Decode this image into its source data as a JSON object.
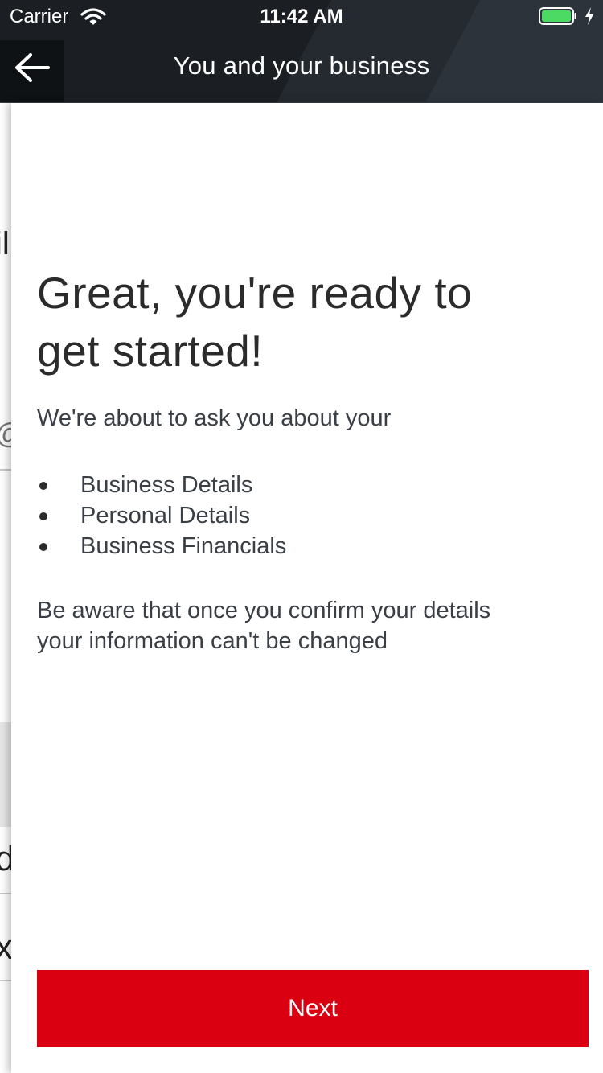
{
  "status_bar": {
    "carrier": "Carrier",
    "time": "11:42 AM",
    "icons": [
      "wifi-icon",
      "battery-icon",
      "charging-icon"
    ],
    "battery_color": "#4cd964"
  },
  "nav": {
    "back_icon": "arrow-left-icon",
    "title": "You and your business"
  },
  "content": {
    "headline_line1": "Great, you're ready to",
    "headline_line2": "get started!",
    "intro": "We're about to ask you about your",
    "topics": [
      "Business Details",
      "Personal Details",
      "Business Financials"
    ],
    "warning_line1": "Be aware that once you confirm your details",
    "warning_line2": "your information can't be changed"
  },
  "underlay": {
    "glyphs": [
      "il",
      "@",
      "d",
      "x"
    ]
  },
  "actions": {
    "next_label": "Next"
  },
  "colors": {
    "header_background": "#1b1f24",
    "primary_button": "#db0011",
    "text": "#2b2b2b"
  }
}
